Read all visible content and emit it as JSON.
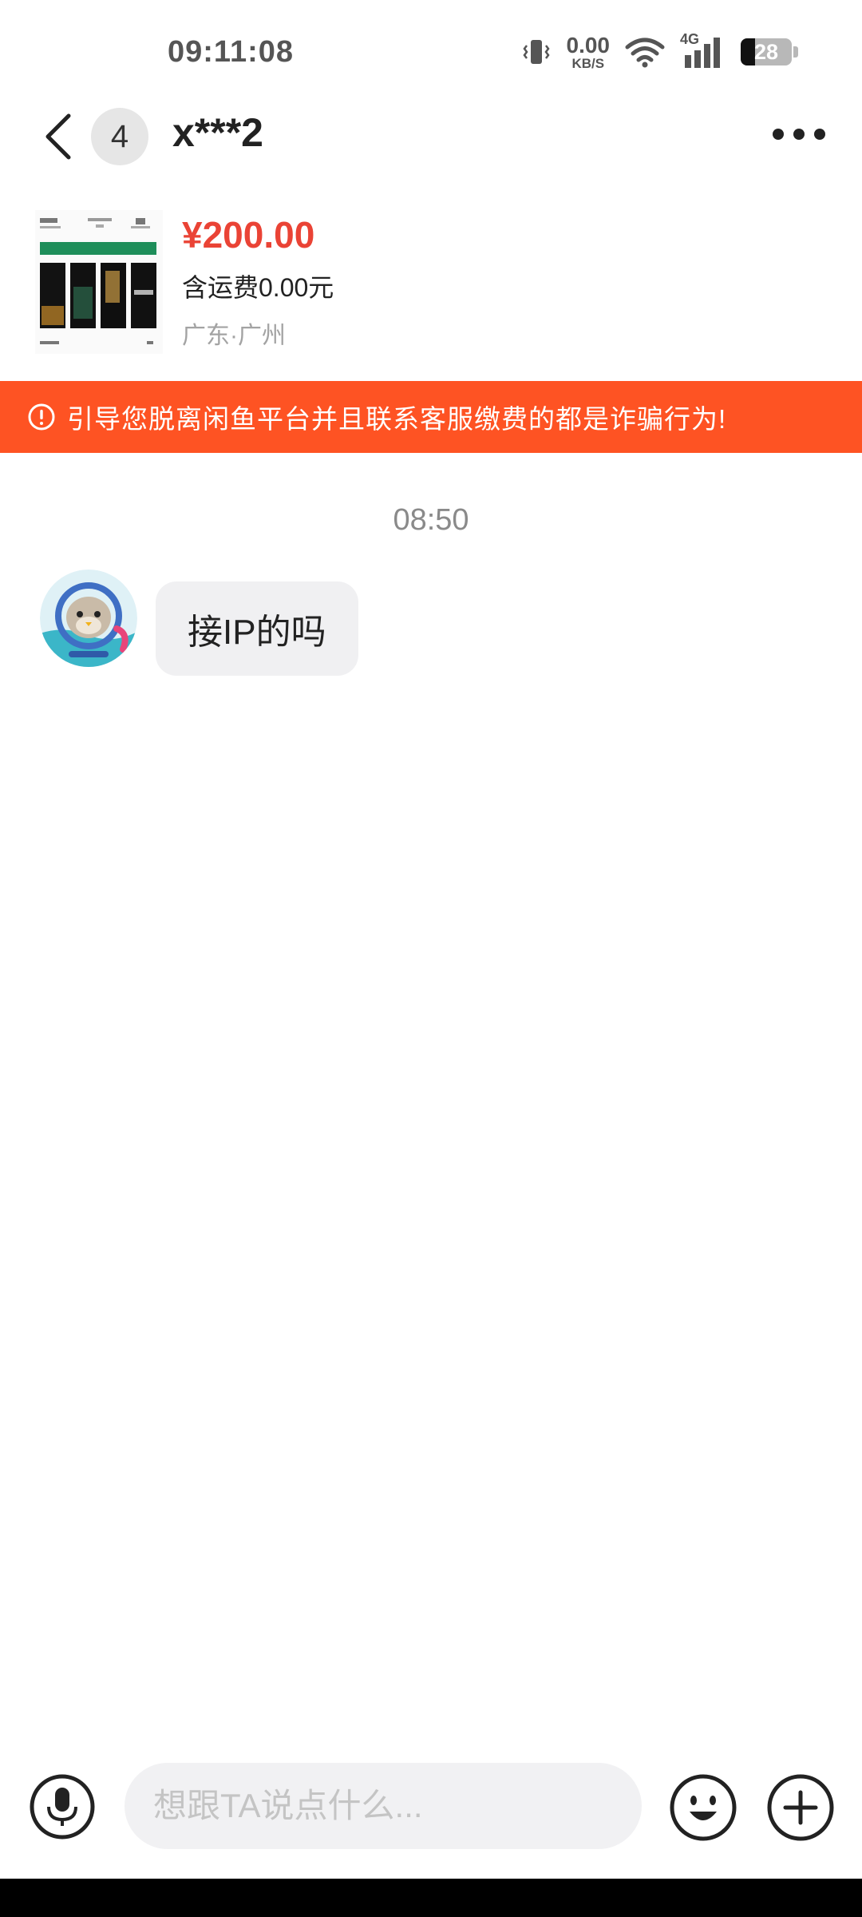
{
  "status_bar": {
    "time": "09:11:08",
    "net_speed_value": "0.00",
    "net_speed_unit": "KB/S",
    "network_type": "4G",
    "battery_level": "28"
  },
  "header": {
    "unread_count": "4",
    "title": "x***2"
  },
  "product": {
    "price": "¥200.00",
    "shipping": "含运费0.00元",
    "location": "广东·广州"
  },
  "warning": {
    "text": "引导您脱离闲鱼平台并且联系客服缴费的都是诈骗行为!"
  },
  "conversation": {
    "time": "08:50",
    "messages": [
      {
        "text": "接IP的吗"
      }
    ]
  },
  "input": {
    "placeholder": "想跟TA说点什么..."
  },
  "colors": {
    "price_red": "#ea4335",
    "warning_bg": "#fe5323",
    "bubble_bg": "#f0f0f2"
  },
  "icons": [
    "vibrate-icon",
    "wifi-icon",
    "signal-icon",
    "battery-icon",
    "back-arrow-icon",
    "more-icon",
    "warning-icon",
    "microphone-icon",
    "emoji-icon",
    "plus-icon"
  ]
}
